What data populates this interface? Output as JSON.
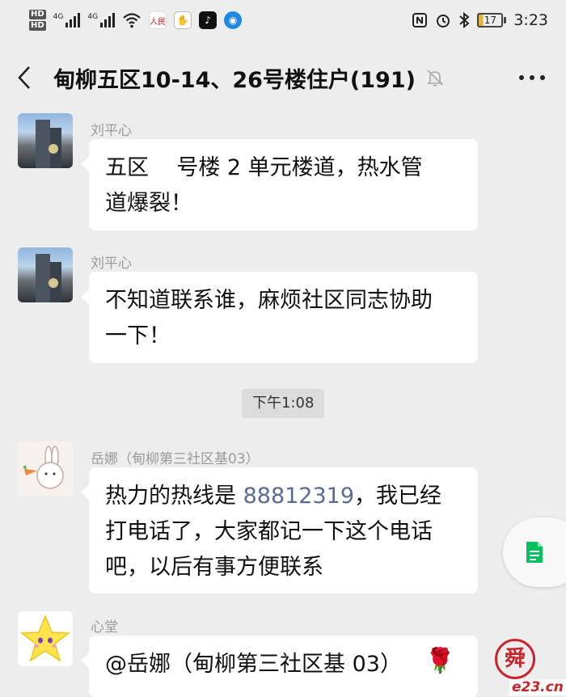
{
  "status_bar": {
    "hd1": "HD",
    "hd2": "HD",
    "sim1": "4G",
    "sim2": "4G",
    "app_icons": [
      "people-daily-icon",
      "hand-icon",
      "tiktok-icon",
      "browser-icon"
    ],
    "icons": [
      "nfc-icon",
      "alarm-icon",
      "bluetooth-icon"
    ],
    "battery": "17",
    "time": "3:23"
  },
  "header": {
    "title": "甸柳五区10-14、26号楼住户(191)",
    "muted": true
  },
  "messages": [
    {
      "sender": "刘平心",
      "lines": [
        "五区    号楼 2 单元楼道，热水管",
        "道爆裂！"
      ]
    },
    {
      "sender": "刘平心",
      "lines": [
        "不知道联系谁，麻烦社区同志协助",
        "一下！"
      ]
    },
    {
      "sender": "岳娜（甸柳第三社区基03）",
      "line1_prefix": "热力的热线是 ",
      "line1_phone": "88812319",
      "line1_suffix": "，我已经",
      "lines": [
        "打电话了，大家都记一下这个电话",
        "吧，以后有事方便联系"
      ]
    },
    {
      "sender": "心堂",
      "lines": [
        "@岳娜（甸柳第三社区基 03）"
      ]
    }
  ],
  "timestamp": "下午1:08",
  "watermark": {
    "seal": "舜",
    "site": "e23.cn"
  },
  "colors": {
    "background": "#ededed",
    "bubble": "#ffffff",
    "link": "#576b95",
    "accent": "#07c160"
  }
}
